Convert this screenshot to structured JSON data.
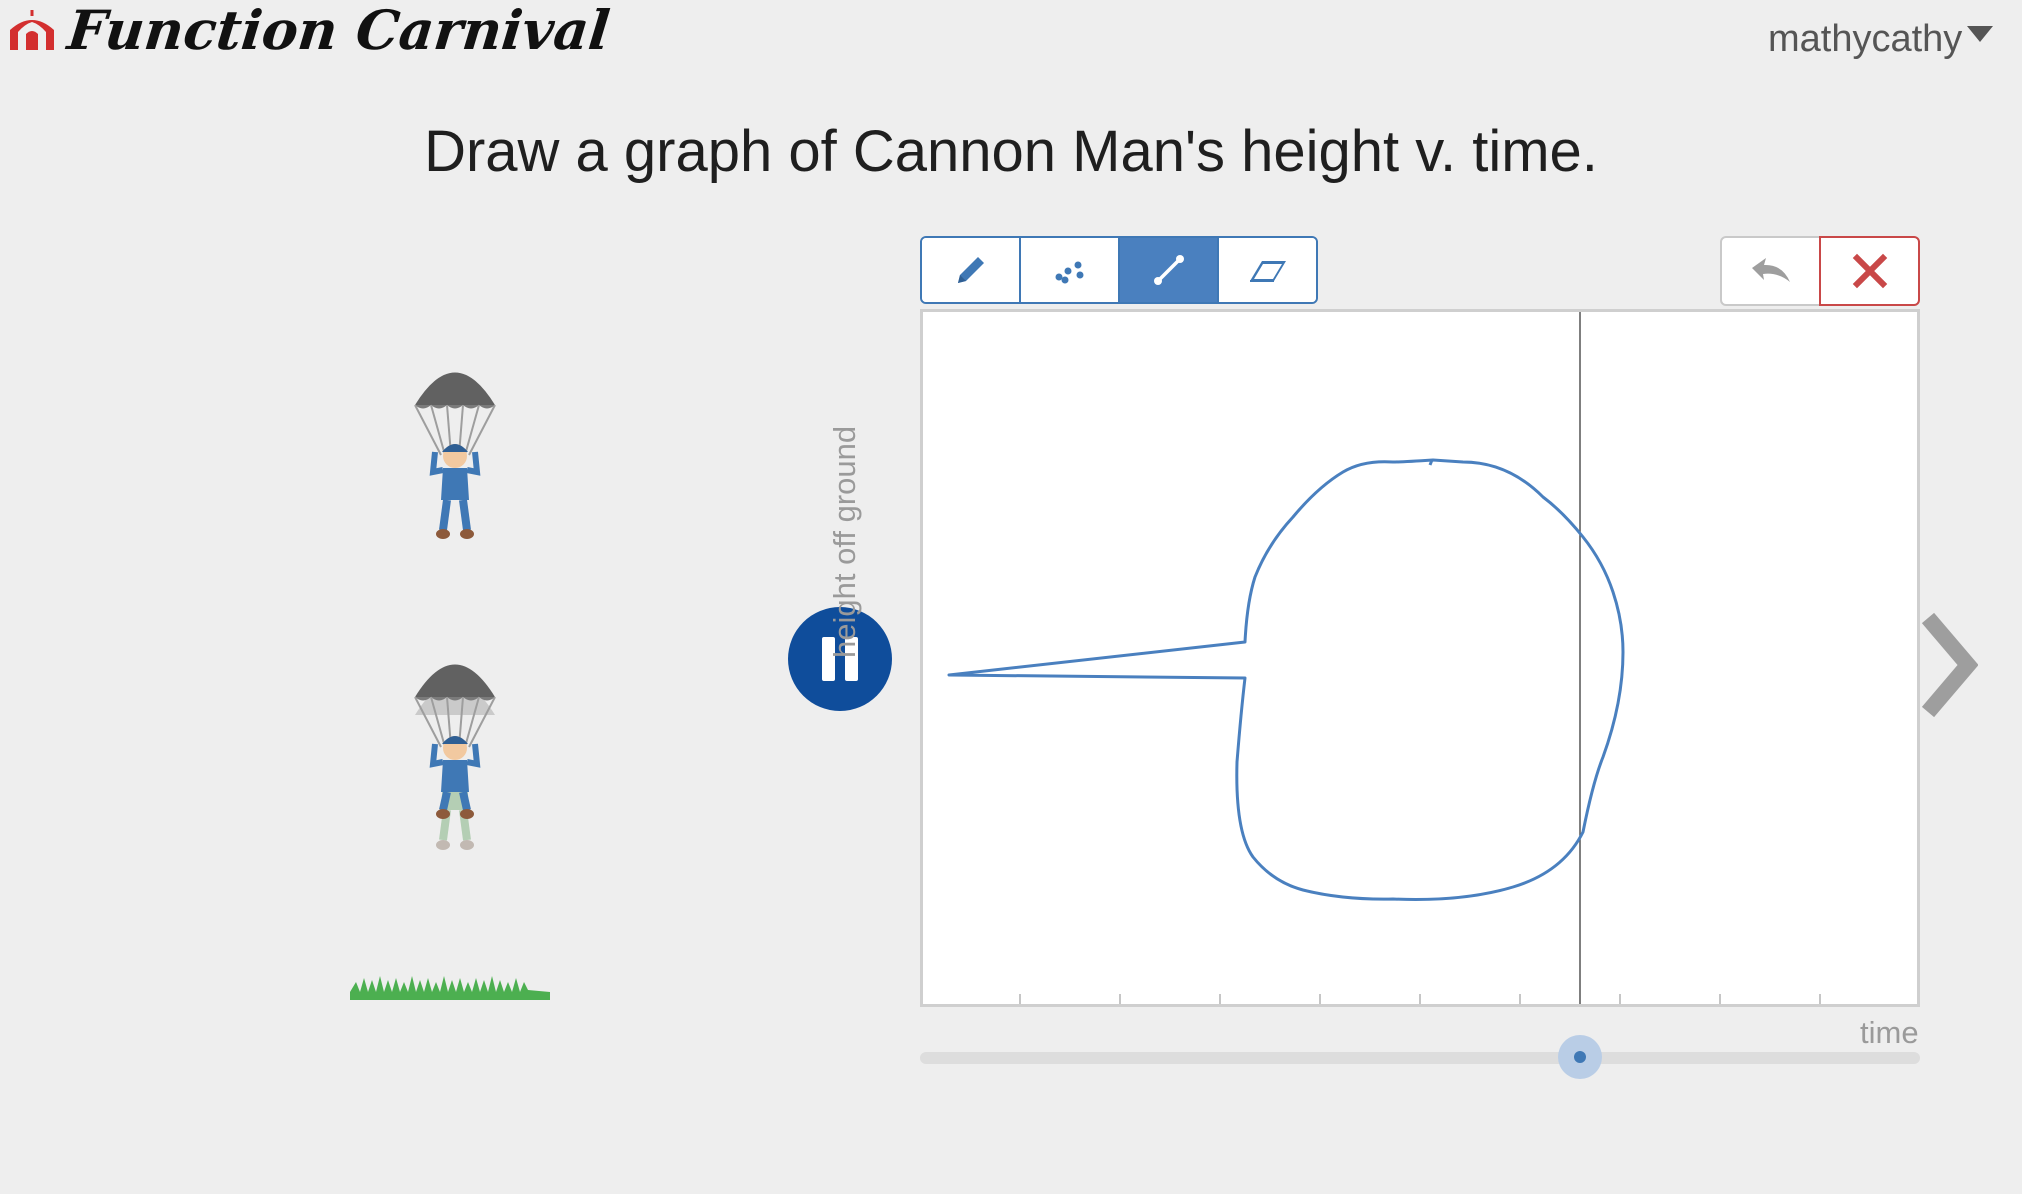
{
  "header": {
    "app_title": "Function Carnival",
    "user": "mathycathy"
  },
  "instruction": "Draw a graph of Cannon Man's height v. time.",
  "toolbar": {
    "tools": [
      {
        "name": "pencil-icon",
        "active": false
      },
      {
        "name": "points-icon",
        "active": false
      },
      {
        "name": "line-segment-icon",
        "active": true
      },
      {
        "name": "eraser-icon",
        "active": false
      }
    ],
    "actions": [
      "undo-icon",
      "clear-icon"
    ]
  },
  "graph": {
    "ylabel": "height off ground",
    "xlabel": "time"
  },
  "playback": {
    "state_icon": "pause-icon",
    "progress": 0.66
  },
  "colors": {
    "accent": "#3f78b5",
    "pause_bg": "#0f4d9b",
    "clear": "#c94848",
    "grass": "#4caf50"
  }
}
